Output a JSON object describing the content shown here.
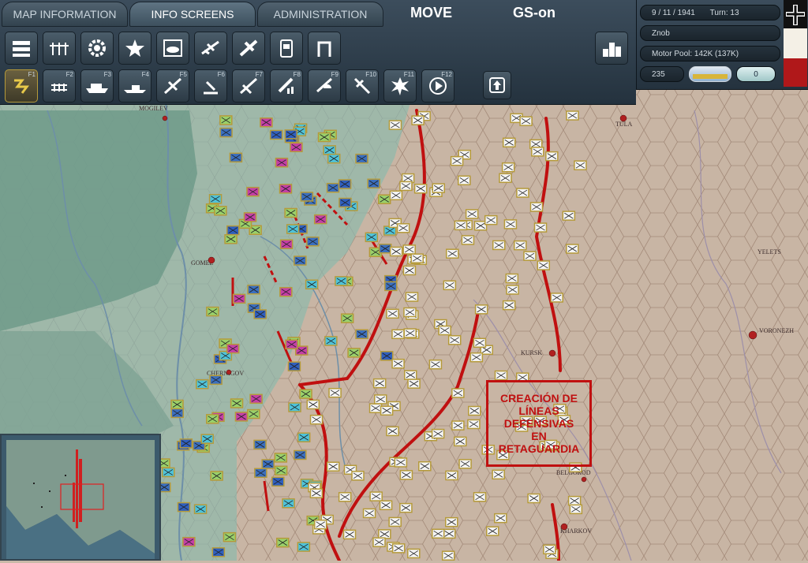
{
  "tabs": [
    {
      "label": "MAP INFORMATION"
    },
    {
      "label": "INFO SCREENS"
    },
    {
      "label": "ADMINISTRATION"
    }
  ],
  "mode_label": "MOVE",
  "status_label": "GS-on",
  "panel": {
    "date": "9 / 11 / 1941",
    "turn": "Turn: 13",
    "player": "Znob",
    "motor_pool": "Motor Pool:  142K (137K)",
    "points": "235",
    "counter": "0"
  },
  "fkeys": [
    "F1",
    "F2",
    "F3",
    "F4",
    "F5",
    "F6",
    "F7",
    "F8",
    "F9",
    "F10",
    "F11",
    "F12"
  ],
  "cities": [
    {
      "name": "MOGILEV"
    },
    {
      "name": "GOMEL"
    },
    {
      "name": "CHERNIGOV"
    },
    {
      "name": "TULA"
    },
    {
      "name": "KURSK"
    },
    {
      "name": "VORONEZH"
    },
    {
      "name": "YELETS"
    },
    {
      "name": "BELGOROD"
    },
    {
      "name": "KHARKOV"
    }
  ],
  "annotation": [
    "CREACIÓN DE",
    "LÍNEAS",
    "DEFENSIVAS",
    "EN",
    "RETAGUARDIA"
  ],
  "colors": {
    "annotation": "#c01010",
    "panel": "#2d3c48",
    "soviet_unit": "#f4f4f4",
    "german_unit": "#3b6fbf"
  }
}
